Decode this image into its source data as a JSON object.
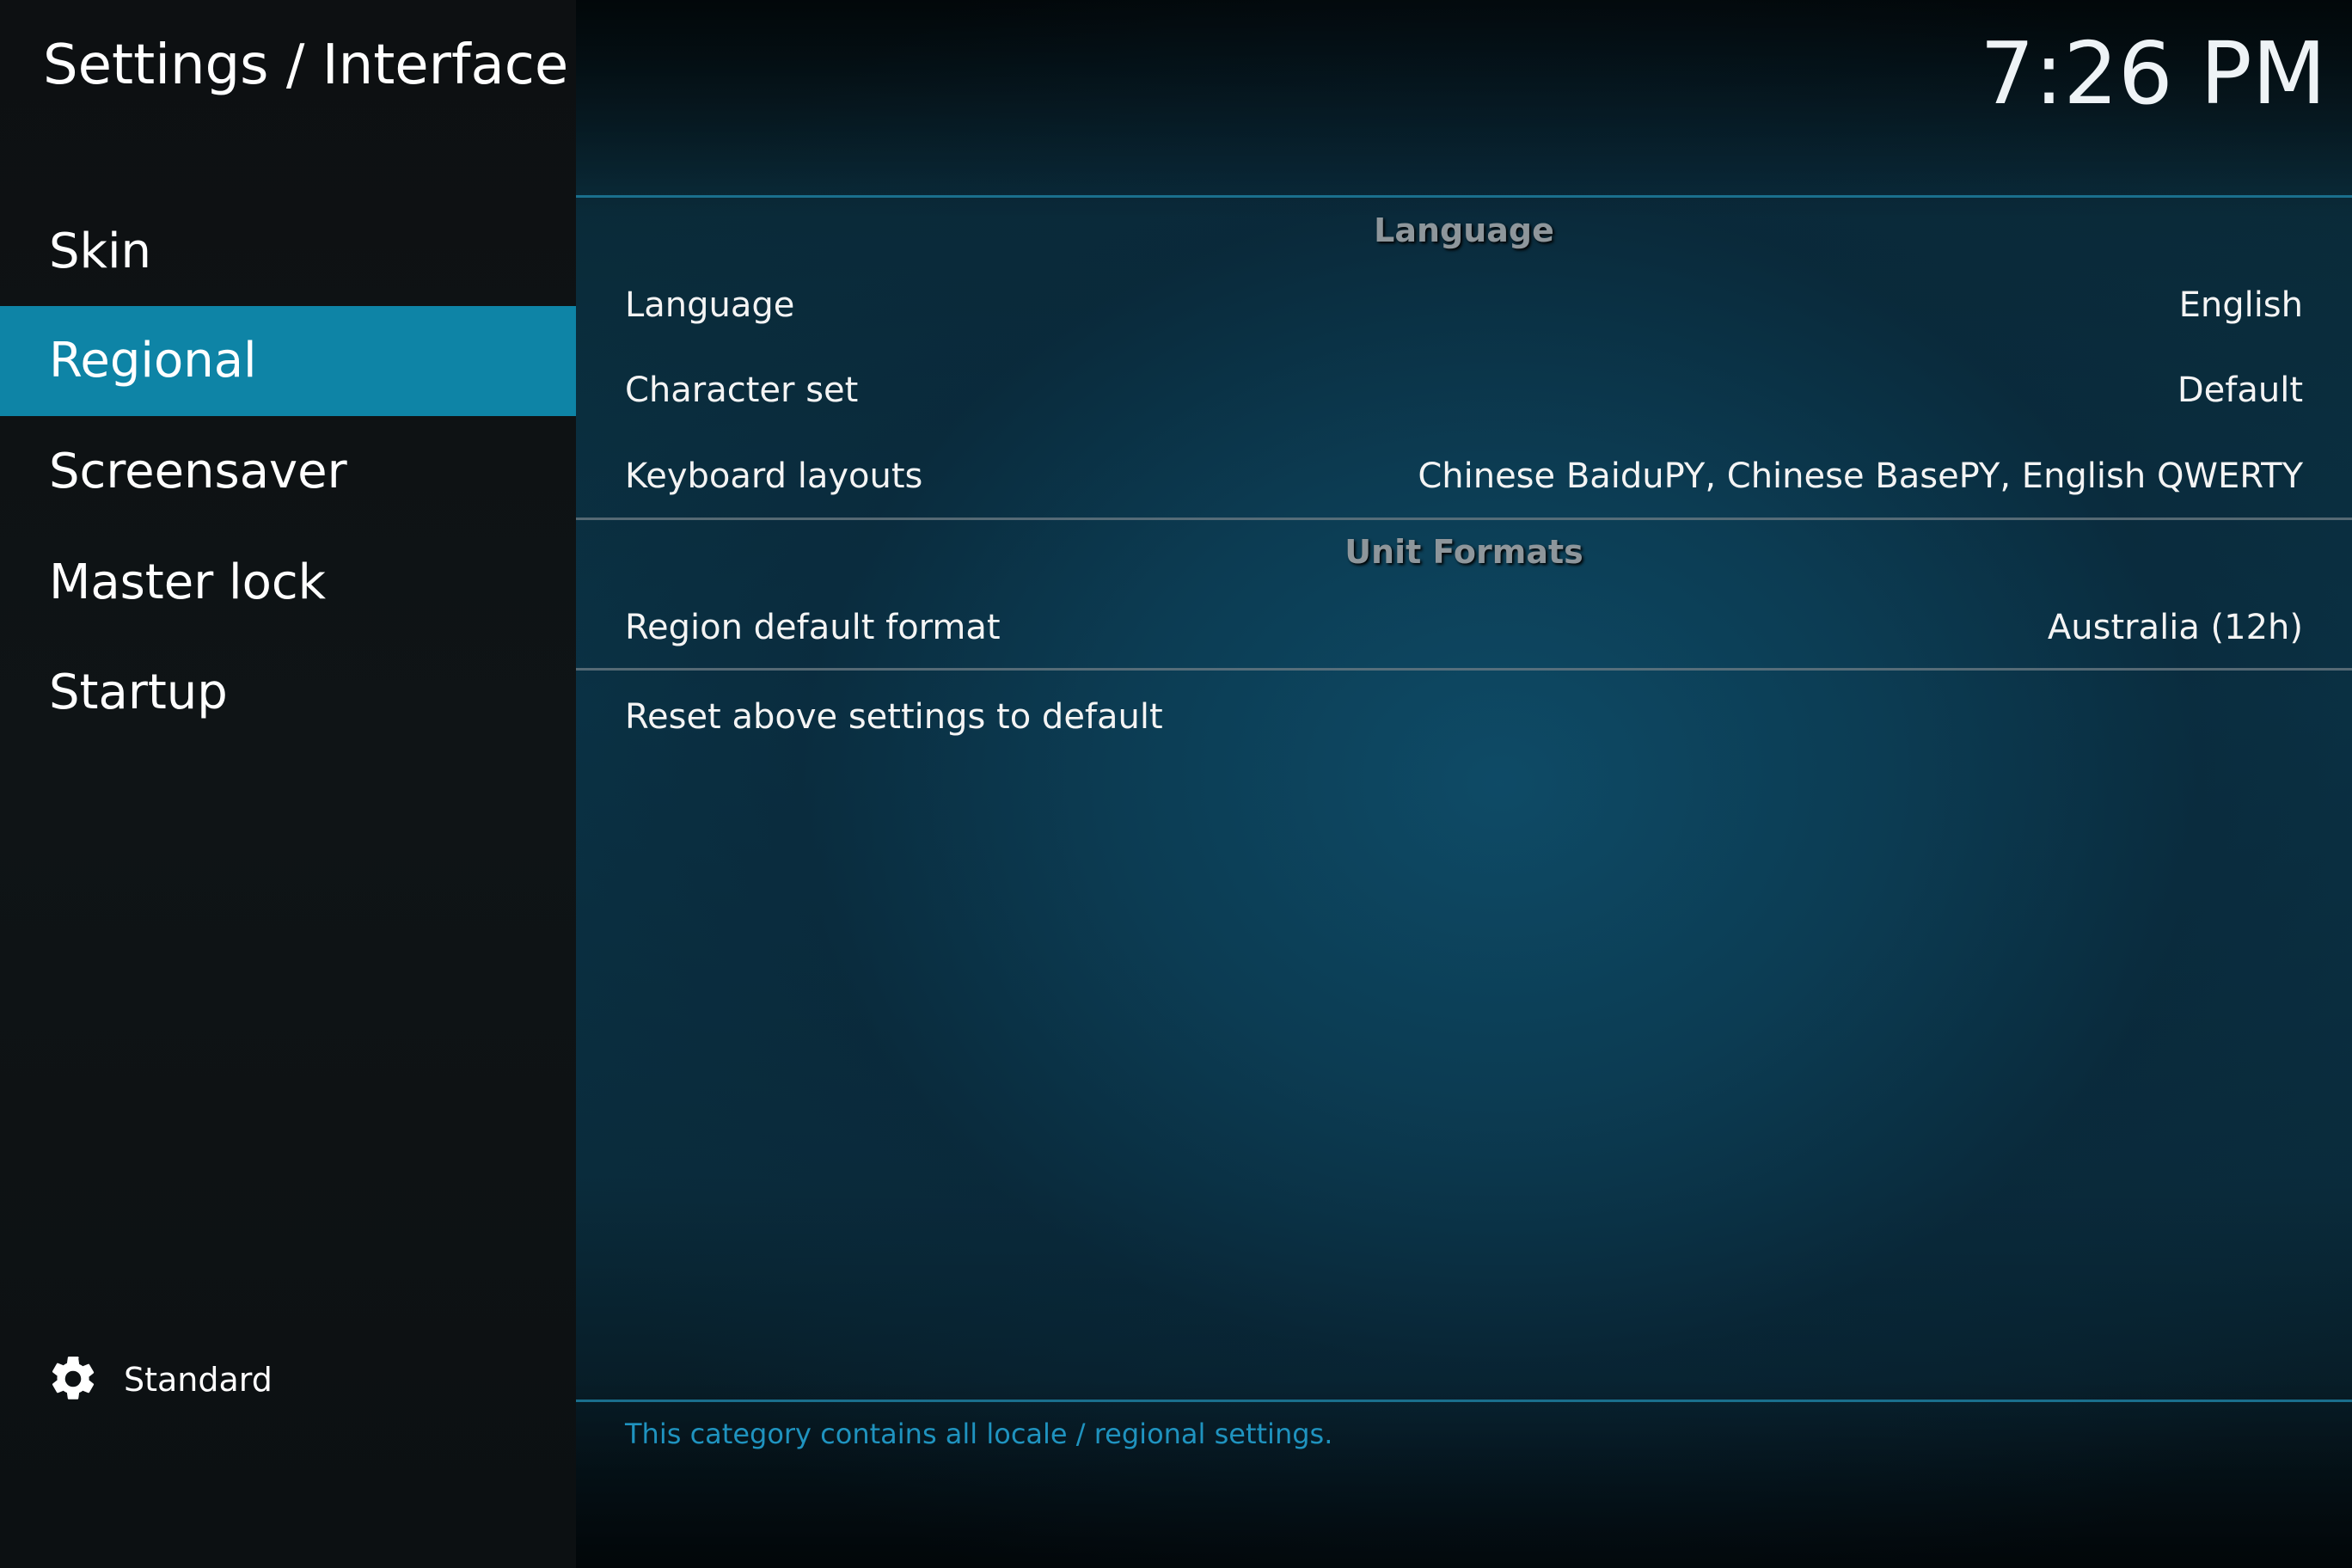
{
  "header": {
    "title": "Settings / Interface",
    "clock": "7:26 PM"
  },
  "sidebar": {
    "items": [
      {
        "label": "Skin",
        "active": false
      },
      {
        "label": "Regional",
        "active": true
      },
      {
        "label": "Screensaver",
        "active": false
      },
      {
        "label": "Master lock",
        "active": false
      },
      {
        "label": "Startup",
        "active": false
      }
    ],
    "settings_level": {
      "icon": "gear-icon",
      "label": "Standard"
    }
  },
  "main": {
    "sections": [
      {
        "header": "Language",
        "rows": [
          {
            "label": "Language",
            "value": "English"
          },
          {
            "label": "Character set",
            "value": "Default"
          },
          {
            "label": "Keyboard layouts",
            "value": "Chinese BaiduPY, Chinese BasePY, English QWERTY"
          }
        ]
      },
      {
        "header": "Unit Formats",
        "rows": [
          {
            "label": "Region default format",
            "value": "Australia (12h)"
          }
        ]
      }
    ],
    "reset_label": "Reset above settings to default",
    "description": "This category contains all locale / regional settings."
  },
  "colors": {
    "accent": "#0e84a6",
    "description_text": "#1f93bf",
    "section_header": "#8e969b"
  }
}
